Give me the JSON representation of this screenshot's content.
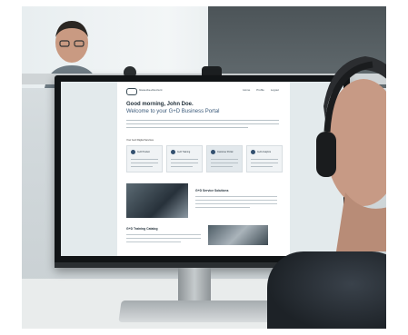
{
  "site": {
    "logo_text": "Giesecke+Devrient",
    "nav": [
      "Home",
      "Profile",
      "Logout"
    ],
    "greeting": "Good morning, John Doe.",
    "welcome": "Welcome to your G+D Business Portal",
    "section_label": "Your G+D Digital Services",
    "cards": [
      "G+D Product",
      "G+D Training",
      "Customer Portal",
      "G+D Analytics"
    ],
    "service_heading": "G+D Service Solutions",
    "training_heading": "G+D Training Catalog"
  }
}
